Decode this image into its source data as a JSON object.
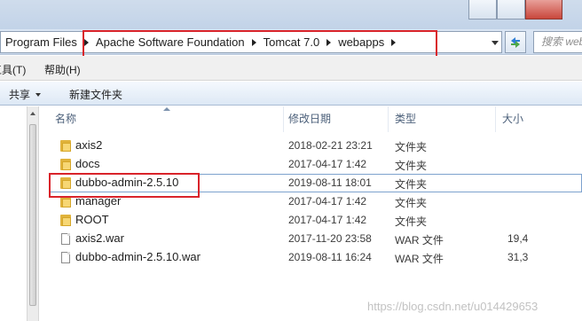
{
  "address_bar": {
    "breadcrumbs": [
      "Program Files",
      "Apache Software Foundation",
      "Tomcat 7.0",
      "webapps"
    ],
    "search_placeholder": "搜索 web"
  },
  "menu": {
    "tools": "工具(T)",
    "help": "帮助(H)"
  },
  "toolbar": {
    "share": "共享",
    "new_folder": "新建文件夹"
  },
  "columns": {
    "name": "名称",
    "modified": "修改日期",
    "type": "类型",
    "size": "大小"
  },
  "files": [
    {
      "name": "axis2",
      "modified": "2018-02-21 23:21",
      "type": "文件夹",
      "size": "",
      "icon": "folder-icon"
    },
    {
      "name": "docs",
      "modified": "2017-04-17 1:42",
      "type": "文件夹",
      "size": "",
      "icon": "folder-icon"
    },
    {
      "name": "dubbo-admin-2.5.10",
      "modified": "2019-08-11 18:01",
      "type": "文件夹",
      "size": "",
      "icon": "folder-icon",
      "selected": true
    },
    {
      "name": "manager",
      "modified": "2017-04-17 1:42",
      "type": "文件夹",
      "size": "",
      "icon": "folder-icon"
    },
    {
      "name": "ROOT",
      "modified": "2017-04-17 1:42",
      "type": "文件夹",
      "size": "",
      "icon": "folder-icon"
    },
    {
      "name": "axis2.war",
      "modified": "2017-11-20 23:58",
      "type": "WAR 文件",
      "size": "19,4",
      "icon": "file-icon"
    },
    {
      "name": "dubbo-admin-2.5.10.war",
      "modified": "2019-08-11 16:24",
      "type": "WAR 文件",
      "size": "31,3",
      "icon": "file-icon"
    }
  ],
  "watermark": "https://blog.csdn.net/u014429653",
  "colors": {
    "highlight_box": "#d9232a",
    "selection_border": "#7da2ce",
    "folder": "#f7d774"
  }
}
